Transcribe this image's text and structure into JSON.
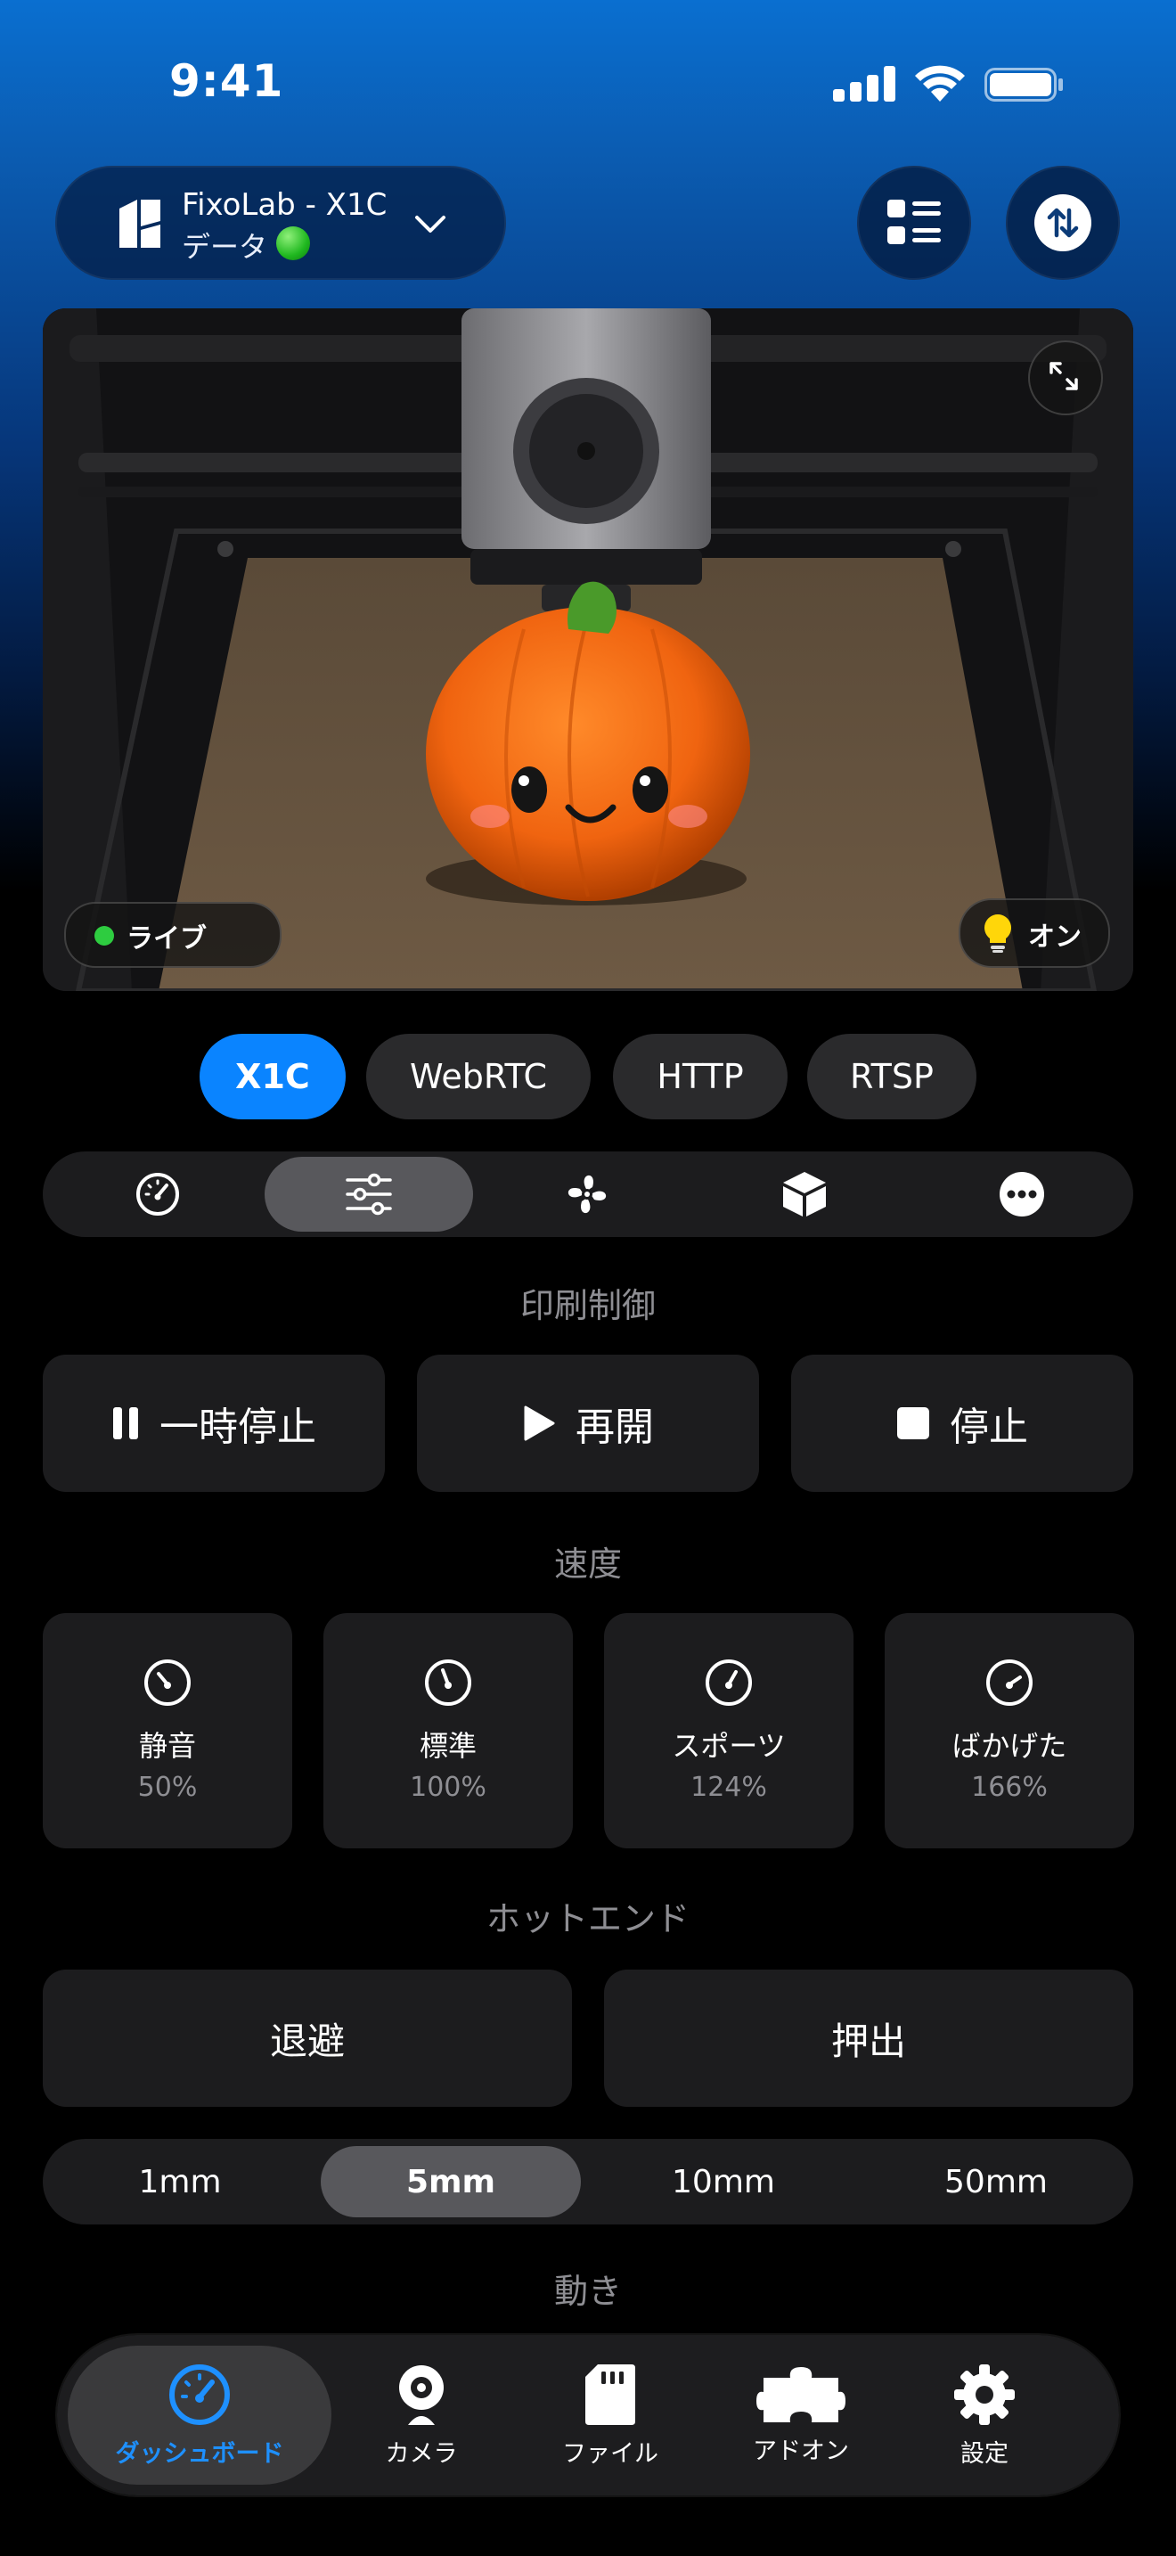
{
  "status_bar": {
    "time": "9:41"
  },
  "header": {
    "printer_name": "FixoLab - X1C",
    "printer_sub": "データ",
    "icons": [
      "printer-logo-icon",
      "chevron-down-icon",
      "list-icon",
      "swap-arrows-icon"
    ]
  },
  "camera": {
    "live_label": "ライブ",
    "light_label": "オン",
    "icons": [
      "expand-icon",
      "lightbulb-icon"
    ]
  },
  "stream_tabs": [
    "X1C",
    "WebRTC",
    "HTTP",
    "RTSP"
  ],
  "stream_selected": "X1C",
  "control_tabs": [
    "gauge-icon",
    "sliders-icon",
    "fan-icon",
    "box-icon",
    "more-icon"
  ],
  "control_selected": "sliders-icon",
  "print_control": {
    "title": "印刷制御",
    "pause": "一時停止",
    "resume": "再開",
    "stop": "停止"
  },
  "speed": {
    "title": "速度",
    "modes": [
      {
        "name": "静音",
        "value": "50%"
      },
      {
        "name": "標準",
        "value": "100%"
      },
      {
        "name": "スポーツ",
        "value": "124%"
      },
      {
        "name": "ばかげた",
        "value": "166%"
      }
    ]
  },
  "hotend": {
    "title": "ホットエンド",
    "retract": "退避",
    "extrude": "押出",
    "distances": [
      "1mm",
      "5mm",
      "10mm",
      "50mm"
    ],
    "distance_selected": "5mm"
  },
  "movement": {
    "title": "動き"
  },
  "tabbar": {
    "items": [
      {
        "label": "ダッシュボード",
        "icon": "dashboard-gauge-icon"
      },
      {
        "label": "カメラ",
        "icon": "webcam-icon"
      },
      {
        "label": "ファイル",
        "icon": "sd-card-icon"
      },
      {
        "label": "アドオン",
        "icon": "puzzle-icon"
      },
      {
        "label": "設定",
        "icon": "gear-icon"
      }
    ],
    "selected": "ダッシュボード"
  },
  "colors": {
    "accent": "#0a84ff",
    "status_green": "#2ecc40",
    "card": "#1c1c1e"
  }
}
